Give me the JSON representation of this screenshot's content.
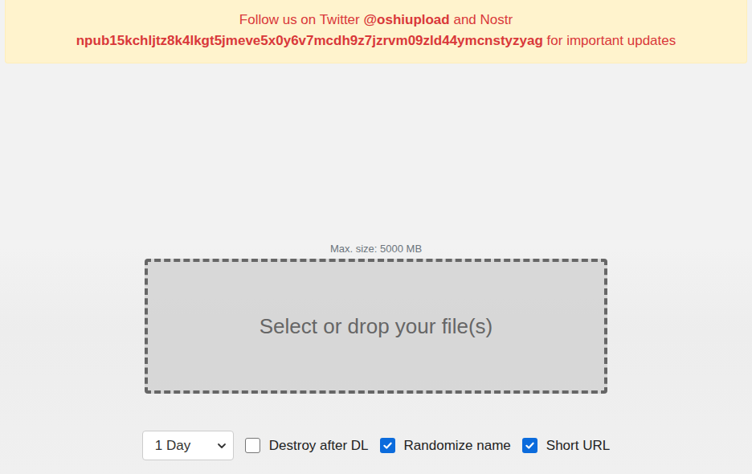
{
  "banner": {
    "lines": [
      [
        {
          "text": "Follow us on Twitter ",
          "bold": false
        },
        {
          "text": "@oshiupload",
          "bold": true
        },
        {
          "text": " and Nostr",
          "bold": false
        }
      ],
      [
        {
          "text": "npub15kchljtz8k4lkgt5jmeve5x0y6v7mcdh9z7jzrvm09zld44ymcnstyzyag",
          "bold": true
        },
        {
          "text": " for important updates",
          "bold": false
        }
      ]
    ]
  },
  "upload": {
    "max_size": "Max. size: 5000 MB",
    "dropzone": "Select or drop your file(s)"
  },
  "options": {
    "expiry": {
      "value": "1 Day"
    },
    "checkboxes": [
      {
        "label": "Destroy after DL",
        "checked": false
      },
      {
        "label": "Randomize name",
        "checked": true
      },
      {
        "label": "Short URL",
        "checked": true
      }
    ]
  }
}
